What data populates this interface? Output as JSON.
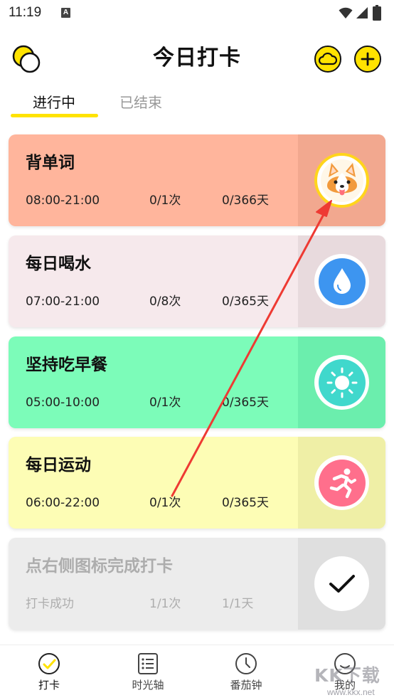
{
  "status": {
    "time": "11:19",
    "notification_glyph": "A"
  },
  "header": {
    "title": "今日打卡",
    "theme_icon": "theme-toggle-icon",
    "cloud_icon": "cloud-icon",
    "add_icon": "plus-icon"
  },
  "tabs": [
    {
      "label": "进行中",
      "active": true
    },
    {
      "label": "已结束",
      "active": false
    }
  ],
  "cards": [
    {
      "title": "背单词",
      "time": "08:00-21:00",
      "count": "0/1次",
      "days": "0/366天",
      "bg": "#ffb59c",
      "side": "#f2a88f",
      "icon": "corgi-avatar-icon"
    },
    {
      "title": "每日喝水",
      "time": "07:00-21:00",
      "count": "0/8次",
      "days": "0/365天",
      "bg": "#f6e9ec",
      "side": "#e8dadd",
      "icon": "water-drop-icon"
    },
    {
      "title": "坚持吃早餐",
      "time": "05:00-10:00",
      "count": "0/1次",
      "days": "0/365天",
      "bg": "#7cfcb9",
      "side": "#6beead",
      "icon": "sun-icon"
    },
    {
      "title": "每日运动",
      "time": "06:00-22:00",
      "count": "0/1次",
      "days": "0/365天",
      "bg": "#fdfdb5",
      "side": "#efefa6",
      "icon": "running-icon"
    },
    {
      "title": "点右侧图标完成打卡",
      "time": "打卡成功",
      "count": "1/1次",
      "days": "1/1天",
      "bg": "#ececec",
      "side": "#dfdfdf",
      "icon": "checkmark-icon"
    }
  ],
  "nav": [
    {
      "label": "打卡",
      "icon": "check-circle-icon",
      "active": true
    },
    {
      "label": "时光轴",
      "icon": "timeline-icon",
      "active": false
    },
    {
      "label": "番茄钟",
      "icon": "clock-icon",
      "active": false
    },
    {
      "label": "我的",
      "icon": "profile-icon",
      "active": false
    }
  ],
  "watermark": {
    "text": "KK下载",
    "url": "www.kkx.net"
  },
  "colors": {
    "accent": "#ffe300",
    "annotation_arrow": "#ee3a33",
    "water": "#3d95f0",
    "sun": "#40d8cc",
    "run": "#ff6f8c"
  }
}
